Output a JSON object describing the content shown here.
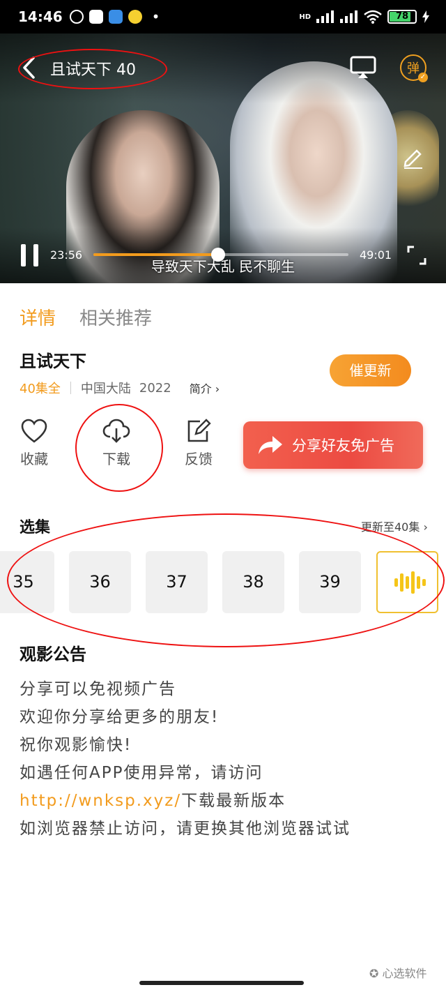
{
  "status_bar": {
    "time": "14:46",
    "battery": "78",
    "signal_label": "HD"
  },
  "video": {
    "title": "且试天下 40",
    "current_time": "23:56",
    "total_time": "49:01",
    "progress_fraction": 0.49,
    "subtitle": "导致天下大乱 民不聊生",
    "danmu_label": "弹"
  },
  "tabs": [
    {
      "label": "详情",
      "active": true
    },
    {
      "label": "相关推荐",
      "active": false
    }
  ],
  "show": {
    "title": "且试天下",
    "episodes_all": "40集全",
    "region": "中国大陆",
    "year": "2022",
    "intro_link": "简介 ›",
    "urge_button": "催更新"
  },
  "actions": {
    "favorite": "收藏",
    "download": "下载",
    "feedback": "反馈",
    "share_ad": "分享好友免广告"
  },
  "episodes": {
    "section_title": "选集",
    "update_link": "更新至40集 ›",
    "items": [
      "35",
      "36",
      "37",
      "38",
      "39"
    ]
  },
  "notice": {
    "title": "观影公告",
    "line1": "分享可以免视频广告",
    "line2": "欢迎你分享给更多的朋友!",
    "line3": "祝你观影愉快!",
    "line4": "如遇任何APP使用异常，请访问",
    "line5_link": "http://wnksp.xyz/",
    "line5_rest": "下载最新版本",
    "line6": "如浏览器禁止访问，请更换其他浏览器试试"
  },
  "watermark": "心选软件",
  "colors": {
    "accent": "#f29b1d",
    "annotation_red": "#e11111",
    "share_red": "#ec4b42"
  }
}
